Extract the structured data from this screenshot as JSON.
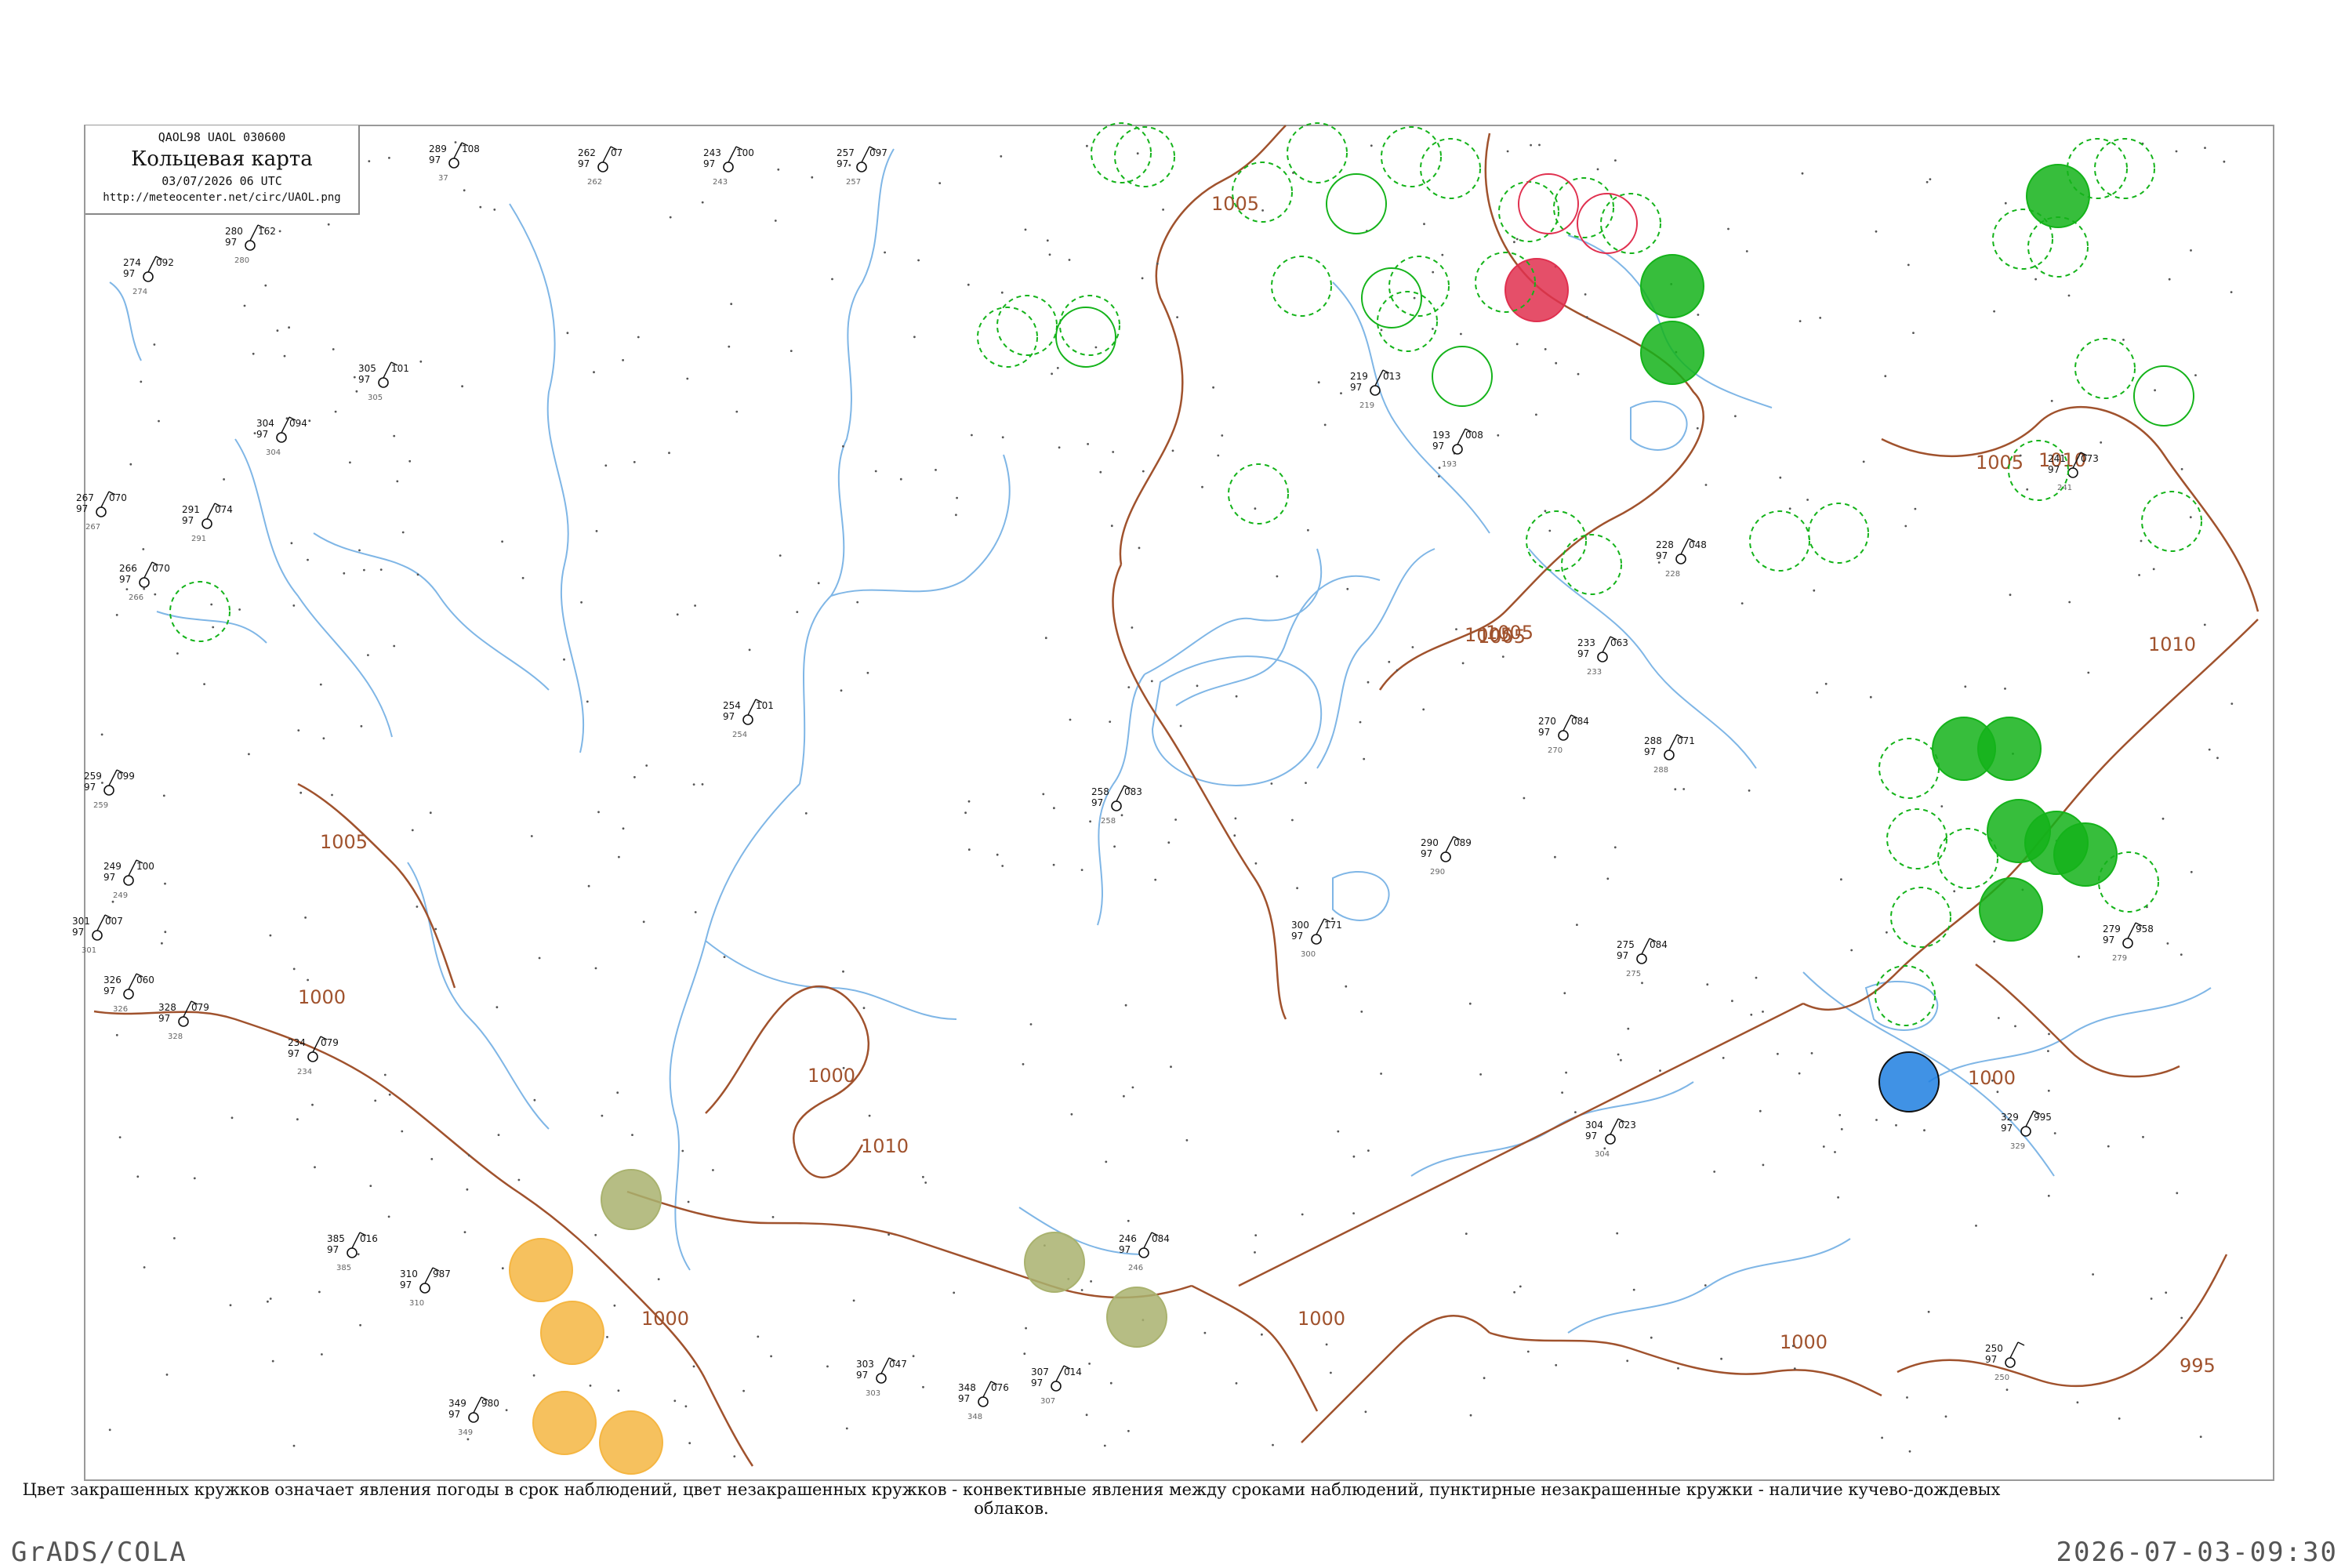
{
  "legend": {
    "code": "QAOL98  UAOL  030600",
    "title": "Кольцевая карта",
    "date": "03/07/2026 06 UTC",
    "url": "http://meteocenter.net/circ/UAOL.png"
  },
  "caption": "Цвет закрашенных кружков означает явления погоды в срок наблюдений, цвет незакрашенных кружков - конвективные явления между сроками наблюдений, пунктирные незакрашенные кружки - наличие кучево-дождевых облаков.",
  "footer": {
    "left": "GrADS/COLA",
    "right": "2026-07-03-09:30"
  },
  "colors": {
    "isobar": "#a0522d",
    "river": "#7fb6e6",
    "thunder_green": "#14b31a",
    "fog_olive": "#a9b26e",
    "haze_orange": "#f5b642",
    "rain_red": "#e0304f",
    "shower_blue": "#1e7fe0"
  },
  "isobar_labels": [
    {
      "text": "1005"
    },
    {
      "text": "1005"
    },
    {
      "text": "1005"
    },
    {
      "text": "1005"
    },
    {
      "text": "1000"
    },
    {
      "text": "1000"
    },
    {
      "text": "1010"
    },
    {
      "text": "1010"
    },
    {
      "text": "1005"
    },
    {
      "text": "1000"
    },
    {
      "text": "1000"
    },
    {
      "text": "1000"
    },
    {
      "text": "1000"
    },
    {
      "text": "995"
    },
    {
      "text": "1010"
    },
    {
      "text": "1005"
    }
  ],
  "stations": [
    {
      "p": "289",
      "t": "97",
      "d": "108",
      "id": "37"
    },
    {
      "p": "262",
      "t": "97",
      "d": "07",
      "id": "262"
    },
    {
      "p": "243",
      "t": "97",
      "d": "100",
      "id": "243"
    },
    {
      "p": "257",
      "t": "97",
      "d": "097",
      "id": "257"
    },
    {
      "p": "280",
      "t": "97",
      "d": "162",
      "id": "280"
    },
    {
      "p": "274",
      "t": "97",
      "d": "092",
      "id": "274"
    },
    {
      "p": "305",
      "t": "97",
      "d": "101",
      "id": "305"
    },
    {
      "p": "304",
      "t": "97",
      "d": "094",
      "id": "304"
    },
    {
      "p": "267",
      "t": "97",
      "d": "070",
      "id": "267"
    },
    {
      "p": "291",
      "t": "97",
      "d": "074",
      "id": "291"
    },
    {
      "p": "266",
      "t": "97",
      "d": "070",
      "id": "266"
    },
    {
      "p": "259",
      "t": "97",
      "d": "099",
      "id": "259"
    },
    {
      "p": "249",
      "t": "97",
      "d": "100",
      "id": "249"
    },
    {
      "p": "301",
      "t": "97",
      "d": "007",
      "id": "301"
    },
    {
      "p": "326",
      "t": "97",
      "d": "060",
      "id": "326"
    },
    {
      "p": "328",
      "t": "97",
      "d": "079",
      "id": "328"
    },
    {
      "p": "234",
      "t": "97",
      "d": "079",
      "id": "234"
    },
    {
      "p": "385",
      "t": "97",
      "d": "016",
      "id": "385"
    },
    {
      "p": "310",
      "t": "97",
      "d": "987",
      "id": "310"
    },
    {
      "p": "349",
      "t": "97",
      "d": "980",
      "id": "349"
    },
    {
      "p": "300",
      "t": "97",
      "d": "171",
      "id": "300"
    },
    {
      "p": "254",
      "t": "97",
      "d": "101",
      "id": "254"
    },
    {
      "p": "258",
      "t": "97",
      "d": "083",
      "id": "258"
    },
    {
      "p": "290",
      "t": "97",
      "d": "089",
      "id": "290"
    },
    {
      "p": "270",
      "t": "97",
      "d": "084",
      "id": "270"
    },
    {
      "p": "275",
      "t": "97",
      "d": "084",
      "id": "275"
    },
    {
      "p": "304",
      "t": "97",
      "d": "023",
      "id": "304"
    },
    {
      "p": "329",
      "t": "97",
      "d": "995",
      "id": "329"
    },
    {
      "p": "250",
      "t": "97",
      "d": "",
      "id": "250"
    },
    {
      "p": "279",
      "t": "97",
      "d": "958",
      "id": "279"
    },
    {
      "p": "241",
      "t": "97",
      "d": "073",
      "id": "241"
    },
    {
      "p": "219",
      "t": "97",
      "d": "013",
      "id": "219"
    },
    {
      "p": "193",
      "t": "97",
      "d": "008",
      "id": "193"
    },
    {
      "p": "228",
      "t": "97",
      "d": "048",
      "id": "228"
    },
    {
      "p": "233",
      "t": "97",
      "d": "063",
      "id": "233"
    },
    {
      "p": "288",
      "t": "97",
      "d": "071",
      "id": "288"
    },
    {
      "p": "303",
      "t": "97",
      "d": "047",
      "id": "303"
    },
    {
      "p": "348",
      "t": "97",
      "d": "076",
      "id": "348"
    },
    {
      "p": "307",
      "t": "97",
      "d": "014",
      "id": "307"
    },
    {
      "p": "246",
      "t": "97",
      "d": "084",
      "id": "246"
    }
  ]
}
